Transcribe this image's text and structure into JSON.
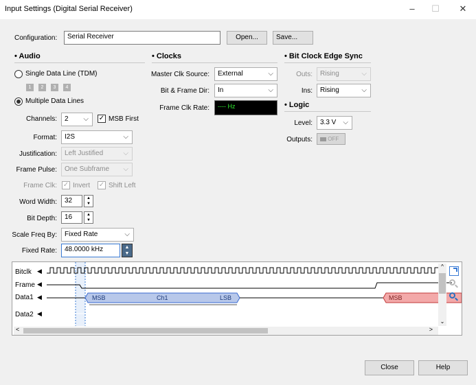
{
  "window": {
    "title": "Input Settings (Digital Serial Receiver)",
    "minimize_glyph": "–",
    "maximize_glyph": "☐",
    "close_glyph": "✕"
  },
  "configuration": {
    "label": "Configuration:",
    "value": "Serial Receiver",
    "open_label": "Open...",
    "save_label": "Save..."
  },
  "audio": {
    "heading": "• Audio",
    "single_line_label": "Single Data Line (TDM)",
    "chips": [
      "1",
      "2",
      "3",
      "4"
    ],
    "multiple_lines_label": "Multiple Data Lines",
    "selected_mode": "multiple",
    "channels_label": "Channels:",
    "channels_value": "2",
    "msb_first_label": "MSB First",
    "msb_first_checked": true,
    "format_label": "Format:",
    "format_value": "I2S",
    "justification_label": "Justification:",
    "justification_value": "Left Justified",
    "frame_pulse_label": "Frame Pulse:",
    "frame_pulse_value": "One Subframe",
    "frame_clk_label": "Frame Clk:",
    "invert_label": "Invert",
    "shift_left_label": "Shift Left",
    "word_width_label": "Word Width:",
    "word_width_value": "32",
    "bit_depth_label": "Bit Depth:",
    "bit_depth_value": "16",
    "scale_freq_label": "Scale Freq By:",
    "scale_freq_value": "Fixed Rate",
    "fixed_rate_label": "Fixed Rate:",
    "fixed_rate_value": "48.0000 kHz"
  },
  "clocks": {
    "heading": "• Clocks",
    "master_src_label": "Master Clk Source:",
    "master_src_value": "External",
    "bit_frame_dir_label": "Bit & Frame Dir:",
    "bit_frame_dir_value": "In",
    "frame_clk_rate_label": "Frame Clk Rate:",
    "frame_clk_rate_value": "---- Hz"
  },
  "bit_clock_edge_sync": {
    "heading": "• Bit Clock Edge Sync",
    "outs_label": "Outs:",
    "outs_value": "Rising",
    "ins_label": "Ins:",
    "ins_value": "Rising"
  },
  "logic": {
    "heading": "• Logic",
    "level_label": "Level:",
    "level_value": "3.3 V",
    "outputs_label": "Outputs:",
    "outputs_value": "OFF"
  },
  "waveform": {
    "signals": [
      "Bitclk",
      "Frame",
      "Data1",
      "Data2"
    ],
    "data1_segments": [
      "MSB",
      "Ch1",
      "LSB",
      "MSB"
    ],
    "colors": {
      "ch1": "#b8c8ea",
      "ch2": "#f0a8a8",
      "cursor": "#3a7bd5"
    }
  },
  "footer": {
    "close_label": "Close",
    "help_label": "Help"
  }
}
